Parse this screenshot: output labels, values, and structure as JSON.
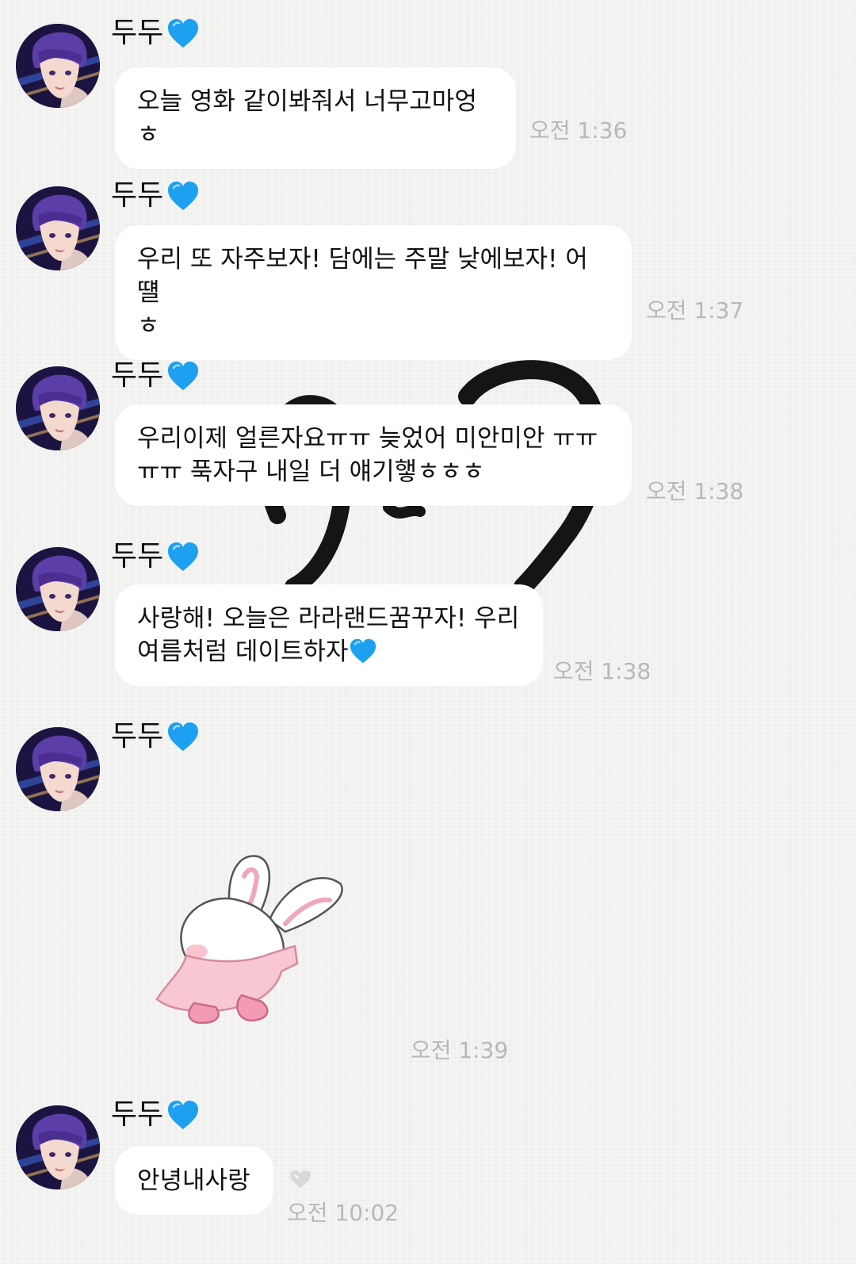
{
  "sender_name": "두두",
  "messages": [
    {
      "text": "오늘 영화 같이봐줘서 너무고마엉ㅎ",
      "time": "오전 1:36"
    },
    {
      "line1": "우리 또 자주보자! 담에는 주말 낮에보자! 어떌",
      "line2": "ㅎ",
      "time": "오전 1:37"
    },
    {
      "line1": "우리이제 얼른자요ㅠㅠ 늦었어 미안미안 ㅠㅠ",
      "line2": "ㅠㅠ 푹자구 내일 더 얘기햏ㅎㅎㅎ",
      "time": "오전 1:38"
    },
    {
      "line1": "사랑해! 오늘은 라라랜드꿈꾸자! 우리",
      "line2": "여름처럼 데이트하자",
      "time": "오전 1:38"
    },
    {
      "sticker": "bunny-in-pink-cape-sticker",
      "time": "오전 1:39"
    },
    {
      "text": "안녕내사랑",
      "time": "오전 10:02"
    }
  ],
  "icons": {
    "heart": "blue-heart-emoji",
    "seen": "gray-heart-icon"
  },
  "colors": {
    "heart_blue": "#1ea0f0",
    "bubble": "#ffffff",
    "time_gray": "#b8b8b8"
  }
}
